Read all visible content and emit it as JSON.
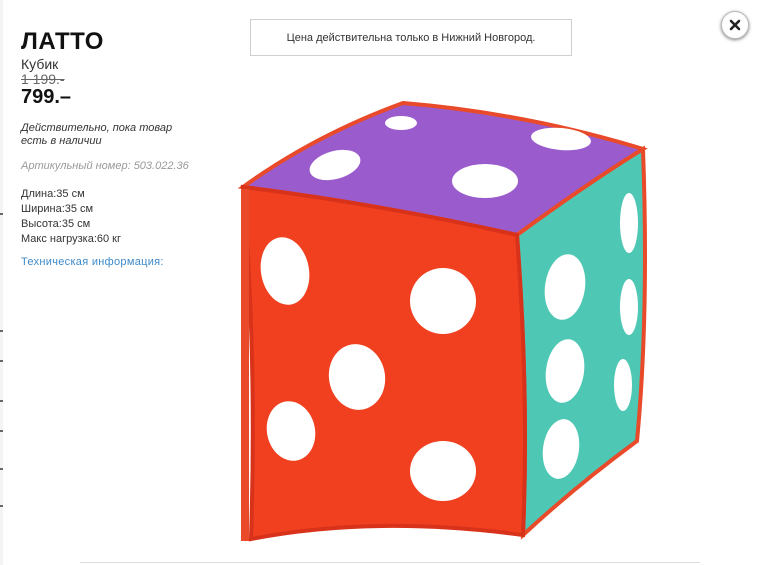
{
  "product": {
    "name": "ЛАТТО",
    "type": "Кубик",
    "old_price": "1 199.-",
    "price": "799.–",
    "availability": "Действительно, пока товар есть в наличии",
    "article_label": "Артикульный номер:",
    "article_number": "503.022.36",
    "specs": [
      {
        "label": "Длина",
        "value": "35 см"
      },
      {
        "label": "Ширина",
        "value": "35 см"
      },
      {
        "label": "Высота",
        "value": "35 см"
      },
      {
        "label": "Макс нагрузка",
        "value": "60 кг"
      }
    ],
    "tech_info_link": "Техническая информация:"
  },
  "notice": "Цена действительна только в Нижний Новгород.",
  "close_icon": "close-icon",
  "colors": {
    "link": "#3d8ac9",
    "cube_red": "#f0401f",
    "cube_purple": "#9a5ccc",
    "cube_teal": "#4ec7b4"
  }
}
